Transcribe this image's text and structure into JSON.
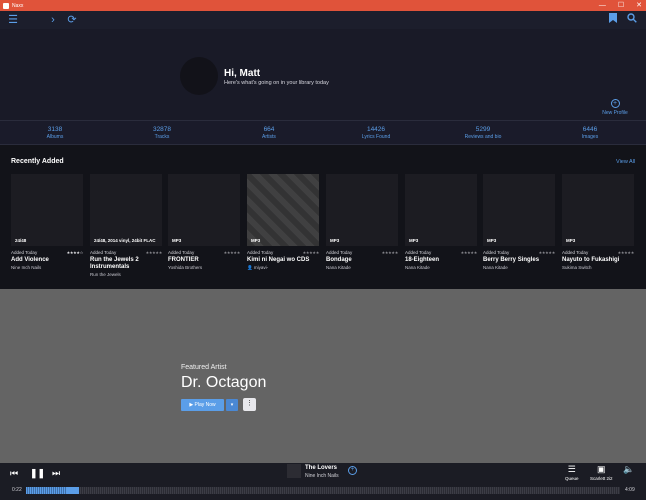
{
  "window": {
    "title": "Naxx",
    "controls": [
      "—",
      "☐",
      "✕"
    ]
  },
  "toolbar": {
    "menu_icon": "hamburger-icon",
    "forward_icon": "chevron-right-icon",
    "refresh_icon": "refresh-icon",
    "bookmark_icon": "bookmark-icon",
    "search_icon": "search-icon"
  },
  "profile": {
    "greeting": "Hi, Matt",
    "subtitle": "Here's what's going on in your library today",
    "new_profile_label": "New Profile"
  },
  "stats": [
    {
      "value": "3138",
      "label": "Albums"
    },
    {
      "value": "32878",
      "label": "Tracks"
    },
    {
      "value": "664",
      "label": "Artists"
    },
    {
      "value": "14426",
      "label": "Lyrics Found"
    },
    {
      "value": "5299",
      "label": "Reviews and bio"
    },
    {
      "value": "6446",
      "label": "Images"
    }
  ],
  "recent": {
    "title": "Recently Added",
    "view_all": "View All",
    "items": [
      {
        "badge": "24/48",
        "added": "Added Today",
        "stars": "★★★★☆",
        "title": "Add Violence",
        "artist": "Nine Inch Nails"
      },
      {
        "badge": "24/48, 2014 vinyl, 24bit FLAC",
        "added": "Added Today",
        "stars": "★★★★★",
        "title": "Run the Jewels 2 Instrumentals",
        "artist": "Run the Jewels"
      },
      {
        "badge": "MP3",
        "added": "Added Today",
        "stars": "★★★★★",
        "title": "FRONTIER",
        "artist": "Yoshida Brothers"
      },
      {
        "badge": "MP3",
        "added": "Added Today",
        "stars": "★★★★★",
        "title": "Kimi ni Negai wo  CDS",
        "artist": "👤 miyavi-"
      },
      {
        "badge": "MP3",
        "added": "Added Today",
        "stars": "★★★★★",
        "title": "Bondage",
        "artist": "Nana Kitade"
      },
      {
        "badge": "MP3",
        "added": "Added Today",
        "stars": "★★★★★",
        "title": "18-Eighteen",
        "artist": "Nana Kitade"
      },
      {
        "badge": "MP3",
        "added": "Added Today",
        "stars": "★★★★★",
        "title": "Berry Berry Singles",
        "artist": "Nana Kitade"
      },
      {
        "badge": "MP3",
        "added": "Added Today",
        "stars": "★★★★★",
        "title": "Nayuto to Fukashigi",
        "artist": "Sukima Switch"
      }
    ]
  },
  "featured": {
    "label": "Featured Artist",
    "name": "Dr. Octagon",
    "play_label": "▶  Play Now",
    "dropdown": "▾",
    "more": "⋮"
  },
  "player": {
    "prev": "⏮",
    "play_pause": "❚❚",
    "next": "⏭",
    "track_title": "The Lovers",
    "track_artist": "Nine Inch Nails",
    "add_icon": "+",
    "queue_label": "Queue",
    "device_label": "Scarlett 2i2",
    "volume_icon": "🔈",
    "elapsed": "0:22",
    "duration": "4:09",
    "progress_fraction": 0.09
  },
  "colors": {
    "accent": "#5b9ee8",
    "titlebar": "#e0533a"
  }
}
